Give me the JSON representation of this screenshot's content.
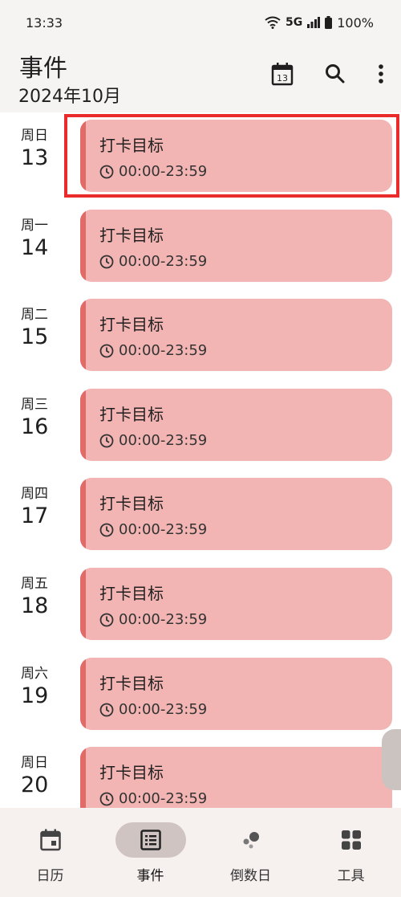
{
  "status_bar": {
    "time": "13:33",
    "signal": "5G",
    "battery": "100%"
  },
  "header": {
    "title": "事件",
    "subtitle": "2024年10月",
    "calendar_day": "13"
  },
  "events": [
    {
      "weekday": "周日",
      "day": "13",
      "title": "打卡目标",
      "time": "00:00-23:59"
    },
    {
      "weekday": "周一",
      "day": "14",
      "title": "打卡目标",
      "time": "00:00-23:59"
    },
    {
      "weekday": "周二",
      "day": "15",
      "title": "打卡目标",
      "time": "00:00-23:59"
    },
    {
      "weekday": "周三",
      "day": "16",
      "title": "打卡目标",
      "time": "00:00-23:59"
    },
    {
      "weekday": "周四",
      "day": "17",
      "title": "打卡目标",
      "time": "00:00-23:59"
    },
    {
      "weekday": "周五",
      "day": "18",
      "title": "打卡目标",
      "time": "00:00-23:59"
    },
    {
      "weekday": "周六",
      "day": "19",
      "title": "打卡目标",
      "time": "00:00-23:59"
    },
    {
      "weekday": "周日",
      "day": "20",
      "title": "打卡目标",
      "time": "00:00-23:59"
    }
  ],
  "nav": [
    {
      "label": "日历",
      "icon": "calendar-icon"
    },
    {
      "label": "事件",
      "icon": "list-icon",
      "active": true
    },
    {
      "label": "倒数日",
      "icon": "countdown-icon"
    },
    {
      "label": "工具",
      "icon": "grid-icon"
    }
  ],
  "colors": {
    "card": "#f3b5b3",
    "card_accent": "#e26a67",
    "highlight": "#ea2b2b",
    "nav_active": "#cfc4c1"
  }
}
